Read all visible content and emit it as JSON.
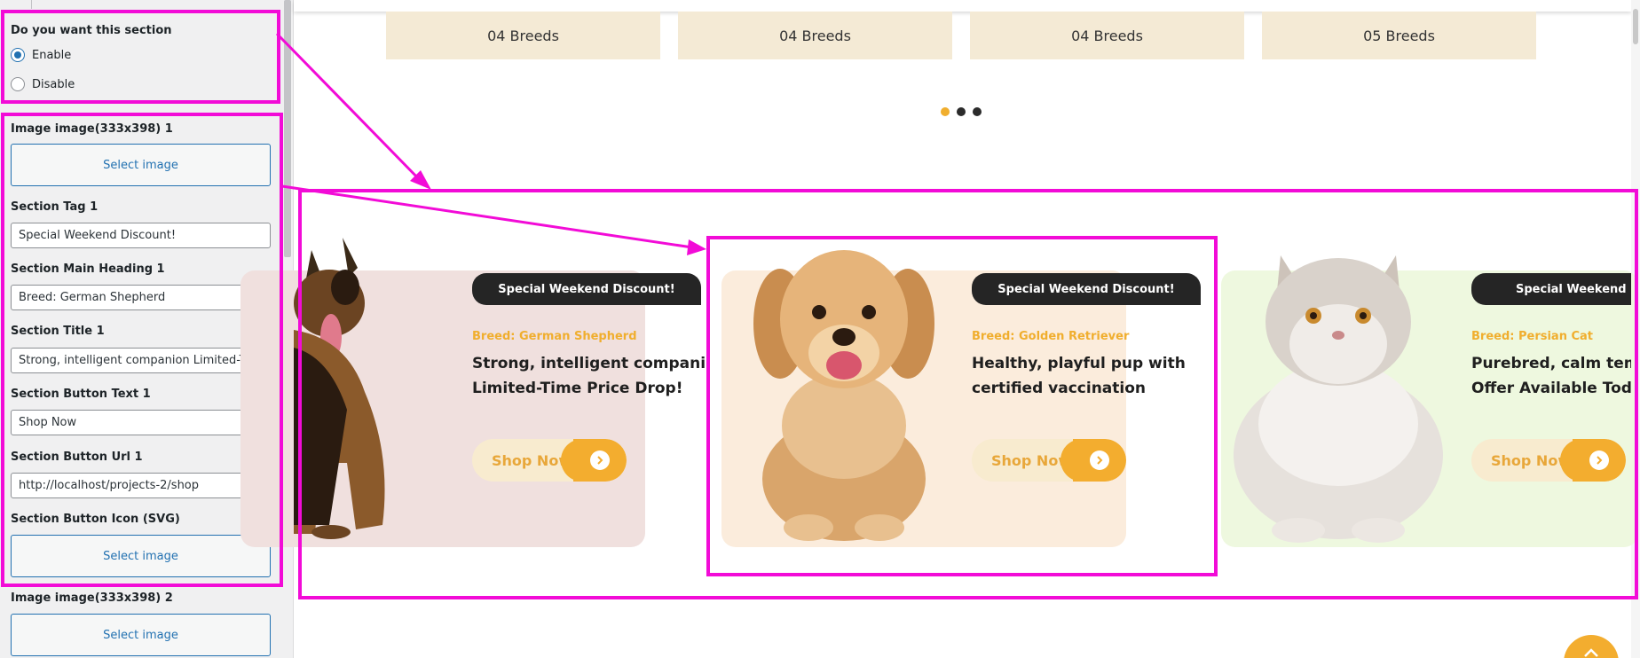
{
  "panel": {
    "section_question": "Do you want this section",
    "enable_label": "Enable",
    "disable_label": "Disable",
    "fields": {
      "image_label_1": "Image image(333x398) 1",
      "select_image": "Select image",
      "tag_label_1": "Section Tag 1",
      "tag_value_1": "Special Weekend Discount!",
      "heading_label_1": "Section Main Heading 1",
      "heading_value_1": "Breed: German Shepherd",
      "title_label_1": "Section Title 1",
      "title_value_1": "Strong, intelligent companion Limited-Time",
      "btn_text_label_1": "Section Button Text 1",
      "btn_text_value_1": "Shop Now",
      "btn_url_label_1": "Section Button Url 1",
      "btn_url_value_1": "http://localhost/projects-2/shop",
      "btn_icon_label_1": "Section Button Icon (SVG)",
      "image_label_2": "Image image(333x398) 2"
    }
  },
  "preview": {
    "breeds": [
      "04 Breeds",
      "04 Breeds",
      "04 Breeds",
      "05 Breeds"
    ],
    "cards": [
      {
        "tag": "Special Weekend Discount!",
        "breed": "Breed: German Shepherd",
        "line1": "Strong, intelligent companion",
        "line2": "Limited-Time Price Drop!",
        "button": "Shop Now",
        "pet_icon": "german-shepherd-image"
      },
      {
        "tag": "Special Weekend Discount!",
        "breed": "Breed: Golden Retriever",
        "line1": "Healthy, playful pup with",
        "line2": "certified vaccination",
        "button": "Shop Now",
        "pet_icon": "golden-retriever-puppy-image"
      },
      {
        "tag": "Special Weekend Discount!",
        "breed": "Breed: Persian Cat",
        "line1": "Purebred, calm temper",
        "line2": "Offer Available Today",
        "button": "Shop Now",
        "pet_icon": "persian-cat-image"
      }
    ],
    "carousel_active_dot": 1,
    "carousel_dot_count": 3
  },
  "colors": {
    "accent": "#f0ae2e",
    "annotation": "#f20bd7",
    "tag_bg": "#252525",
    "wp_blue": "#2271b1"
  }
}
